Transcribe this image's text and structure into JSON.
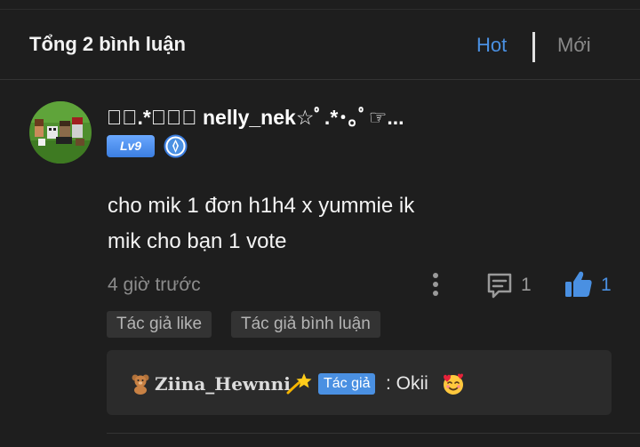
{
  "header": {
    "title": "Tổng 2 bình luận",
    "sort_hot": "Hot",
    "sort_new": "Mới",
    "active_sort": "Hot"
  },
  "comment": {
    "username": "☆ﾟ.*･｡ﾟ nelly_nek☆ﾟ.*･｡ﾟ☞...",
    "level_badge": "Lv9",
    "lines": [
      "cho mik 1 đơn h1h4 x yummie ik",
      "mik cho bạn 1 vote"
    ],
    "time": "4 giờ trước",
    "reply_count": "1",
    "like_count": "1",
    "tags": [
      "Tác giả like",
      "Tác giả bình luận"
    ],
    "icons": [
      "more-vertical-icon",
      "comment-icon",
      "thumbs-up-icon",
      "medal-icon"
    ]
  },
  "reply": {
    "name": "Ziina_Hewnni",
    "author_badge": "Tác giả",
    "text": ": Okii",
    "icons": [
      "teddy-bear-icon",
      "dizzy-star-icon",
      "smiling-face-hearts-icon"
    ]
  },
  "colors": {
    "background": "#1e1e1e",
    "accent": "#4a90e2",
    "muted": "#8c8c8c",
    "reply_box": "#2b2b2b"
  }
}
